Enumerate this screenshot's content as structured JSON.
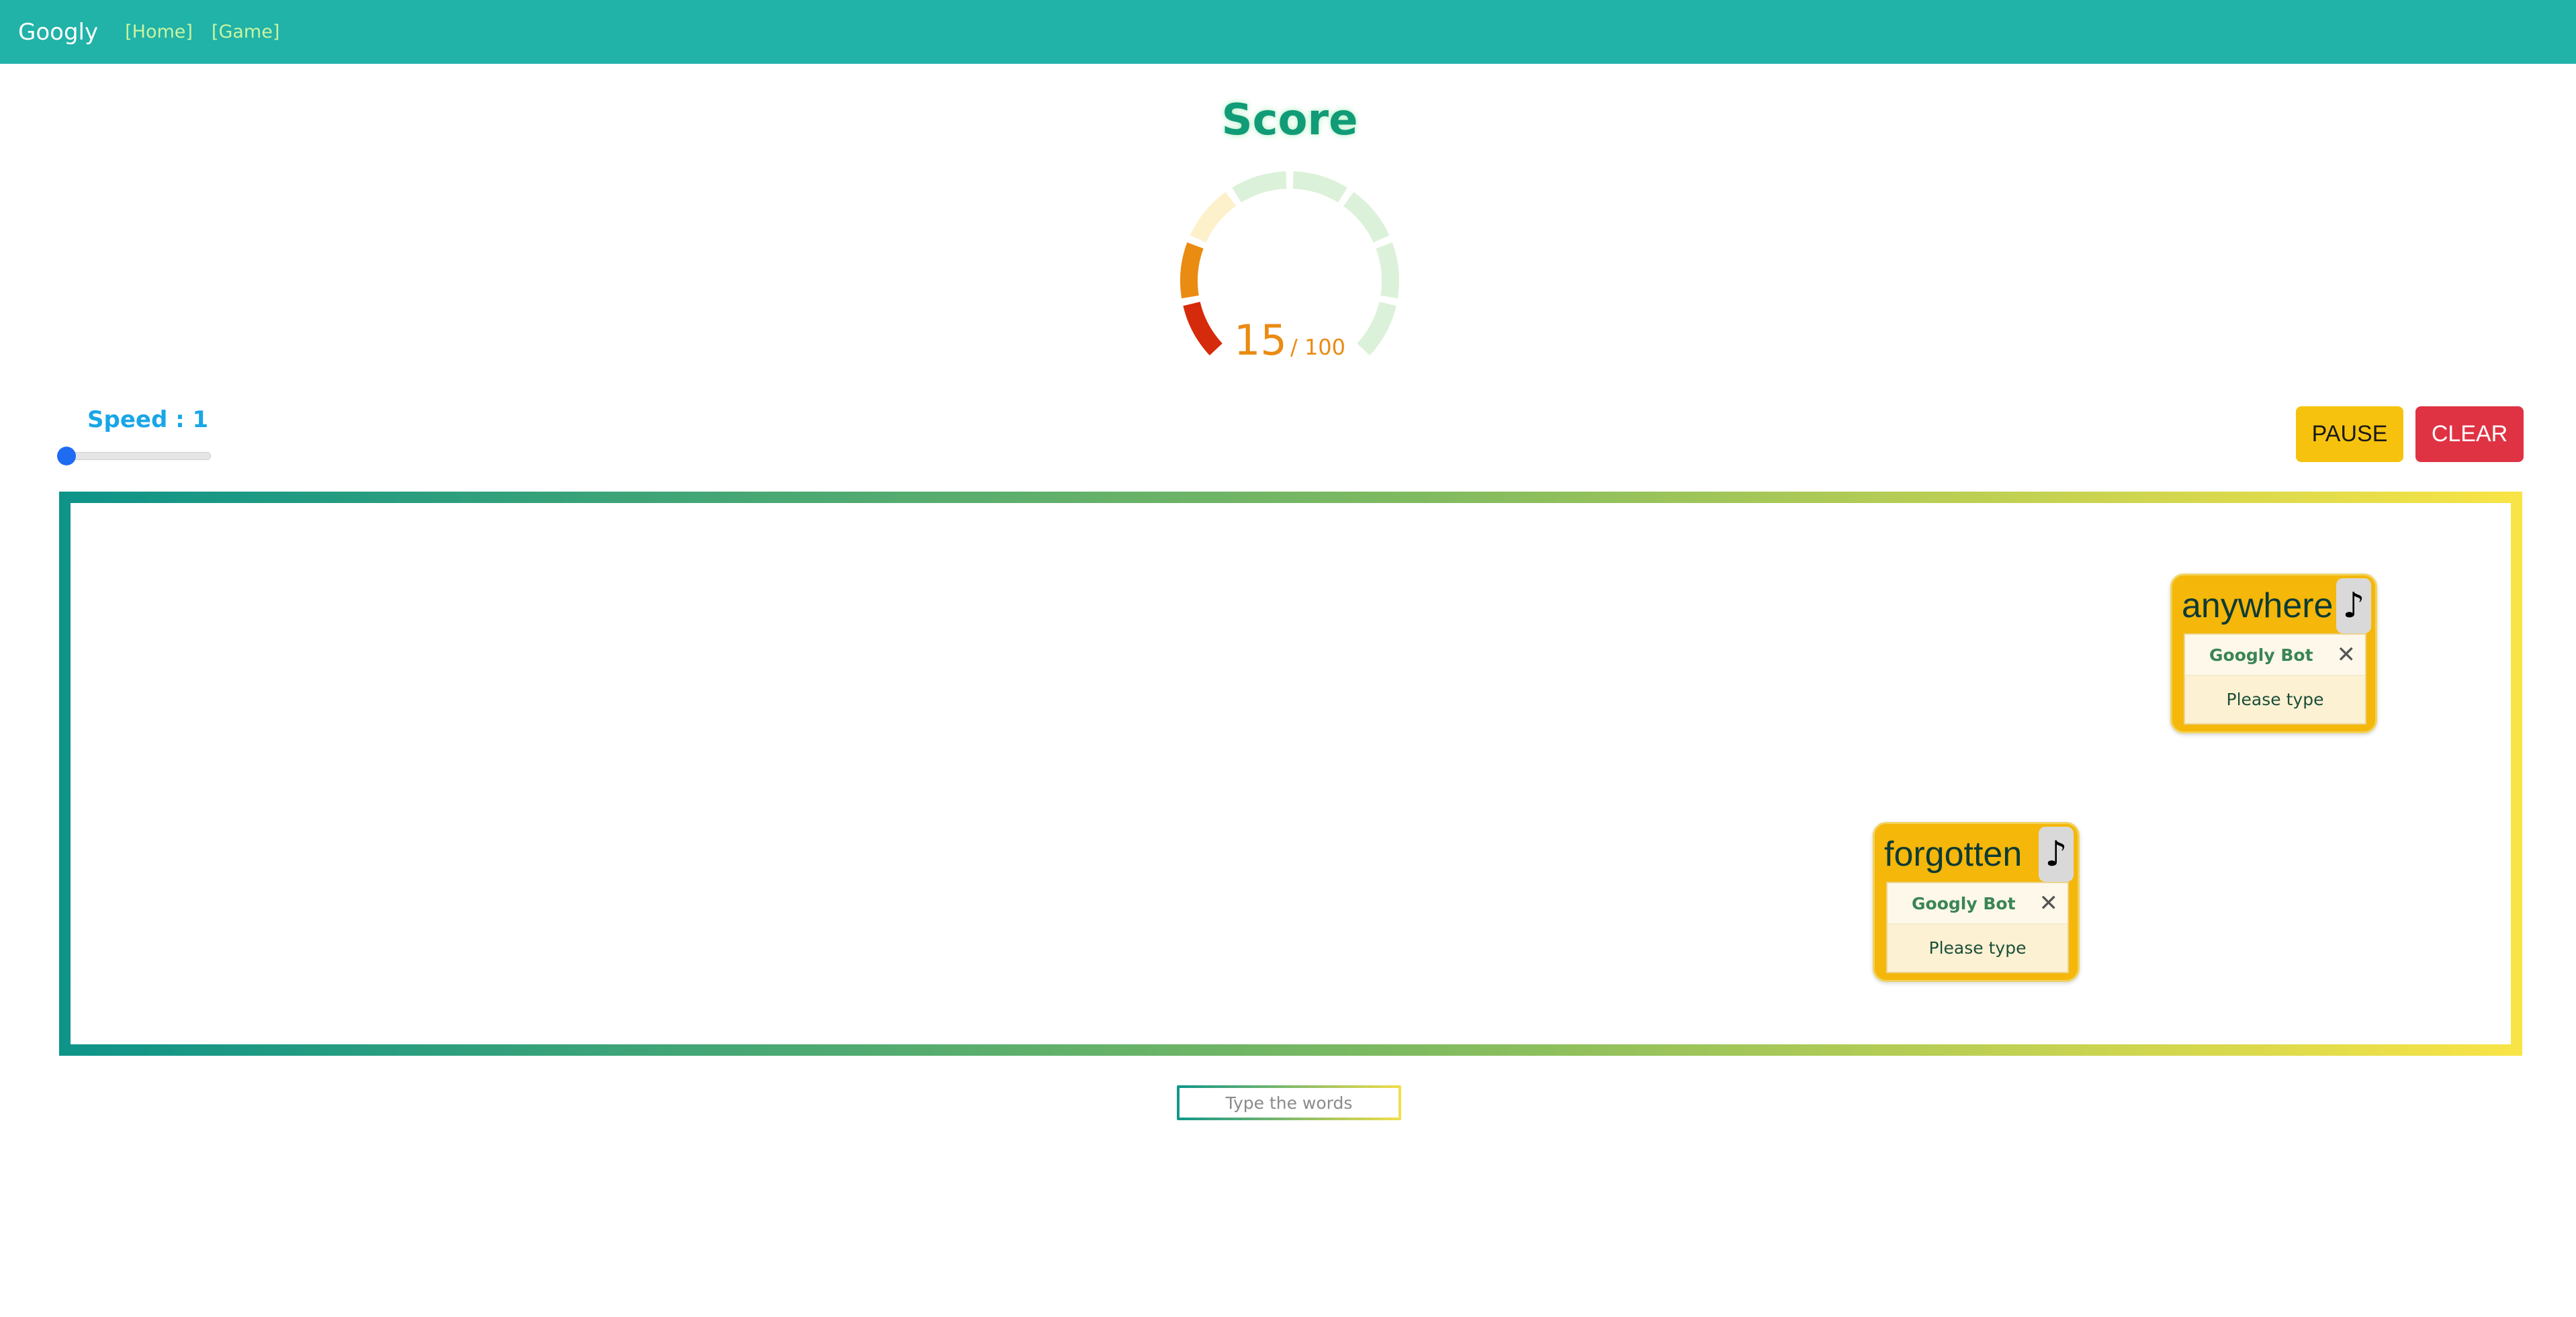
{
  "nav": {
    "brand": "Googly",
    "links": [
      "[Home]",
      "[Game]"
    ]
  },
  "score": {
    "title": "Score",
    "value": "15",
    "max_label": "/ 100",
    "value_num": 15,
    "max_num": 100,
    "colors": {
      "filled_red": "#d52a0b",
      "filled_orange": "#ea8b12",
      "empty_warm": "#fdf1cc",
      "empty_green": "#dcf1d9"
    }
  },
  "speed": {
    "label": "Speed : 1",
    "value": 1,
    "min": 1,
    "max": 10
  },
  "controls": {
    "pause_label": "PAUSE",
    "clear_label": "CLEAR"
  },
  "play_area": {
    "gradient": [
      "#0d9489",
      "#7fba60",
      "#f9e446"
    ],
    "words": [
      {
        "word": "anywhere",
        "icon": "music-note-icon",
        "bot_name": "Googly Bot",
        "message": "Please type"
      },
      {
        "word": "forgotten",
        "icon": "music-note-icon",
        "bot_name": "Googly Bot",
        "message": "Please type"
      }
    ]
  },
  "input": {
    "placeholder": "Type the words"
  }
}
